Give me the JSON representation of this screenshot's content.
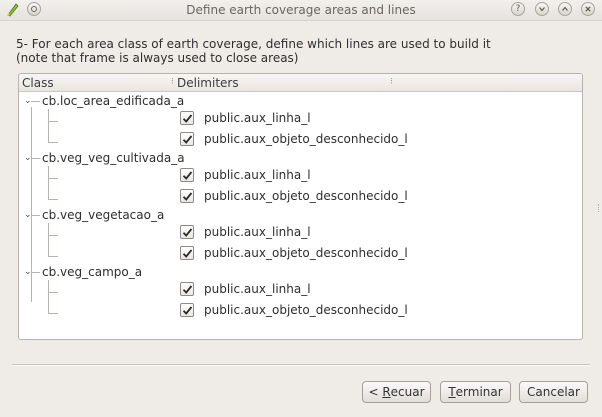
{
  "window": {
    "title": "Define earth coverage areas and lines"
  },
  "instructions": {
    "line1": "5- For each area class of earth coverage, define which lines are used to build it",
    "line2": "(note that frame is always used to close areas)"
  },
  "tree": {
    "columns": [
      "Class",
      "Delimiters"
    ],
    "classes": [
      {
        "name": "cb.loc_area_edificada_a",
        "expanded": true,
        "lines": [
          {
            "label": "public.aux_linha_l",
            "checked": true
          },
          {
            "label": "public.aux_objeto_desconhecido_l",
            "checked": true
          }
        ]
      },
      {
        "name": "cb.veg_veg_cultivada_a",
        "expanded": true,
        "lines": [
          {
            "label": "public.aux_linha_l",
            "checked": true
          },
          {
            "label": "public.aux_objeto_desconhecido_l",
            "checked": true
          }
        ]
      },
      {
        "name": "cb.veg_vegetacao_a",
        "expanded": true,
        "lines": [
          {
            "label": "public.aux_linha_l",
            "checked": true
          },
          {
            "label": "public.aux_objeto_desconhecido_l",
            "checked": true
          }
        ]
      },
      {
        "name": "cb.veg_campo_a",
        "expanded": true,
        "lines": [
          {
            "label": "public.aux_linha_l",
            "checked": true
          },
          {
            "label": "public.aux_objeto_desconhecido_l",
            "checked": true
          }
        ]
      }
    ]
  },
  "buttons": {
    "back": {
      "prefix": "< ",
      "mnemonic": "R",
      "rest": "ecuar"
    },
    "finish": {
      "mnemonic": "T",
      "rest": "erminar"
    },
    "cancel": {
      "label": "Cancelar"
    }
  }
}
